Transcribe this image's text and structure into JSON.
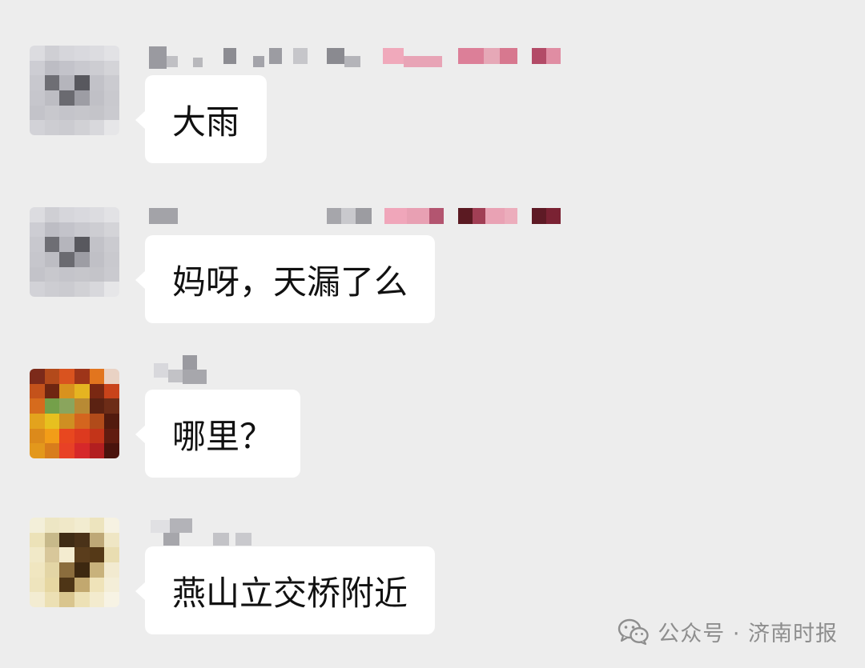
{
  "messages": [
    {
      "text": "大雨"
    },
    {
      "text": "妈呀，天漏了么"
    },
    {
      "text": "哪里？"
    },
    {
      "text": "燕山立交桥附近"
    }
  ],
  "watermark": {
    "text": "公众号 · 济南时报",
    "icon": "wechat-icon"
  },
  "colors": {
    "background": "#ededed",
    "bubble": "#ffffff",
    "text": "#111111",
    "watermark": "#8e8e8e"
  }
}
